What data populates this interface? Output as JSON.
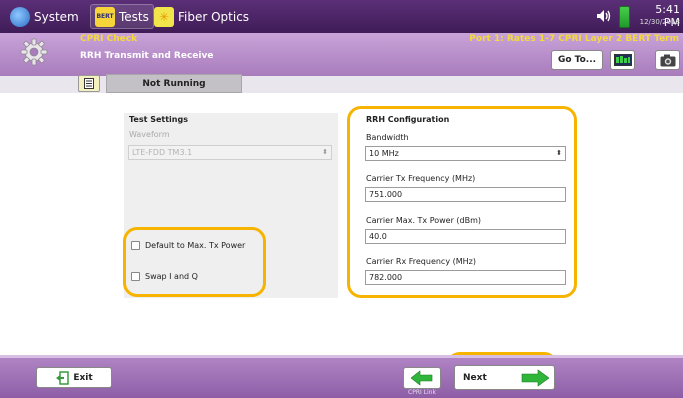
{
  "topbar": {
    "tabs": [
      {
        "label": "System",
        "icon": "system-globe-icon"
      },
      {
        "label": "Tests",
        "icon": "bert-tests-icon",
        "icon_text": "BERT"
      },
      {
        "label": "Fiber Optics",
        "icon": "fiber-optics-icon"
      }
    ],
    "time": "5:41 PM",
    "date": "12/30/2018",
    "speaker_icon": "speaker-icon",
    "battery_icon": "battery-icon",
    "battery_color": "#2fb53a"
  },
  "header": {
    "test_name": "CPRI Check",
    "screen_title": "RRH Transmit and Receive",
    "port_info": "Port 1: Rates 1-7 CPRI Layer 2 BERT Term",
    "goto_label": "Go To...",
    "title_color": "#f5d93c"
  },
  "status": {
    "state": "Not Running"
  },
  "test_settings": {
    "heading": "Test Settings",
    "waveform_label": "Waveform",
    "waveform_value": "LTE-FDD TM3.1",
    "checkbox_max_tx": "Default to Max. Tx Power",
    "checkbox_swap": "Swap I and Q"
  },
  "rrh_config": {
    "heading": "RRH Configuration",
    "bandwidth_label": "Bandwidth",
    "bandwidth_value": "10 MHz",
    "carrier_tx_label": "Carrier Tx Frequency (MHz)",
    "carrier_tx_value": "751.000",
    "max_tx_label": "Carrier Max. Tx Power (dBm)",
    "max_tx_value": "40.0",
    "carrier_rx_label": "Carrier Rx Frequency (MHz)",
    "carrier_rx_value": "782.000"
  },
  "footer": {
    "exit_label": "Exit",
    "back_caption": "CPRI Link",
    "next_label": "Next"
  },
  "highlight_color": "#f6b400"
}
